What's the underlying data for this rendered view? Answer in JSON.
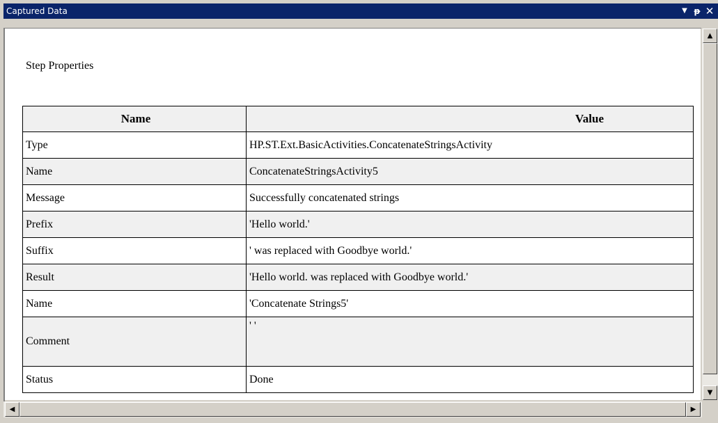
{
  "window": {
    "title": "Captured Data",
    "dropdown_icon": "▼",
    "pin_icon": "ᵽ",
    "close_icon": "✕"
  },
  "content": {
    "heading": "Step Properties",
    "columns": {
      "name": "Name",
      "value": "Value"
    },
    "rows": [
      {
        "name": "Type",
        "value": "HP.ST.Ext.BasicActivities.ConcatenateStringsActivity"
      },
      {
        "name": "Name",
        "value": "ConcatenateStringsActivity5"
      },
      {
        "name": "Message",
        "value": "Successfully concatenated strings"
      },
      {
        "name": "Prefix",
        "value": "'Hello world.'"
      },
      {
        "name": "Suffix",
        "value": "' was replaced with Goodbye world.'"
      },
      {
        "name": "Result",
        "value": "'Hello world. was replaced with Goodbye world.'"
      },
      {
        "name": "Name",
        "value": "'Concatenate Strings5'"
      },
      {
        "name": "Comment",
        "value": "' '"
      },
      {
        "name": "Status",
        "value": "Done"
      }
    ]
  },
  "scrollbars": {
    "up_arrow": "▲",
    "down_arrow": "▼",
    "left_arrow": "◀",
    "right_arrow": "▶"
  },
  "colors": {
    "titlebar": "#0a246a",
    "row_alt": "#f0f0f0",
    "chrome": "#d4d0c8"
  }
}
